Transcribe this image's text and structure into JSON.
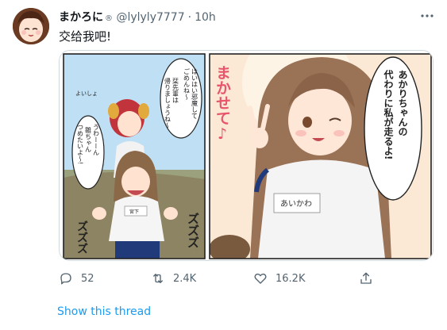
{
  "tweet": {
    "display_name": "まかろに",
    "verified_emoji": "®",
    "handle": "@lylyly7777",
    "separator": "·",
    "time": "10h",
    "text": "交给我吧!",
    "more_icon": "more-icon"
  },
  "manga": {
    "panel1": {
      "bubble_right": [
        "はいはい邪魔して",
        "ごめんね～",
        "栞先輩は",
        "帰りましょうね～"
      ],
      "bubble_left": [
        "うわーーん",
        "雛ちゃん",
        "つめたいよ～!"
      ],
      "sfx_small": "よいしょ",
      "sfx_bottom_right": "ズズズ",
      "sfx_bottom_left": "ズズズ",
      "shirt_name": "宮下"
    },
    "panel2": {
      "sfx_title": "まかせて♪",
      "bubble_text": [
        "あかりちゃんの",
        "代わりに私が走るよ!"
      ],
      "shirt_name": "あいかわ"
    }
  },
  "actions": {
    "reply_count": "52",
    "retweet_count": "2.4K",
    "like_count": "16.2K"
  },
  "thread_link_label": "Show this thread",
  "colors": {
    "link": "#1d9bf0",
    "muted": "#536471",
    "border": "#cfd9de"
  }
}
